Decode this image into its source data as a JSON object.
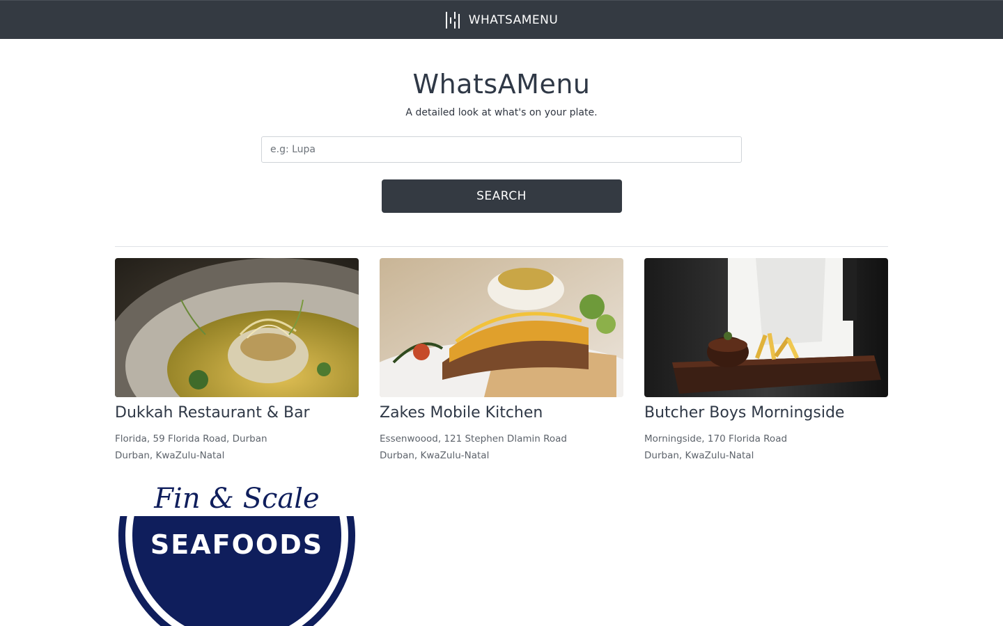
{
  "navbar": {
    "brand_icon": "waveform-bars-icon",
    "brand_label": "WHATSAMENU"
  },
  "hero": {
    "title": "WhatsAMenu",
    "subtitle": "A detailed look at what's on your plate."
  },
  "search": {
    "placeholder": "e.g: Lupa",
    "value": "",
    "button_label": "SEARCH"
  },
  "restaurants": [
    {
      "name": "Dukkah Restaurant & Bar",
      "address_line1": "Florida, 59 Florida Road, Durban",
      "address_line2": "Durban, KwaZulu-Natal",
      "image": "plated-dish-with-sauce"
    },
    {
      "name": "Zakes Mobile Kitchen",
      "address_line1": "Essenwoood, 121 Stephen Dlamin Road",
      "address_line2": "Durban, KwaZulu-Natal",
      "image": "stacked-burger-sandwich"
    },
    {
      "name": "Butcher Boys Morningside",
      "address_line1": "Morningside, 170 Florida Road",
      "address_line2": "Durban, KwaZulu-Natal",
      "image": "steak-and-fries-on-board"
    },
    {
      "name": "",
      "address_line1": "",
      "address_line2": "",
      "image": "fin-and-scale-seafoods-logo",
      "logo_text": "SEAFOODS",
      "logo_arc_text": "Fin & Scale"
    }
  ],
  "colors": {
    "navbar_bg": "#343a42",
    "button_bg": "#343a42",
    "text_dark": "#2f3846",
    "text_muted": "#5d636b"
  }
}
